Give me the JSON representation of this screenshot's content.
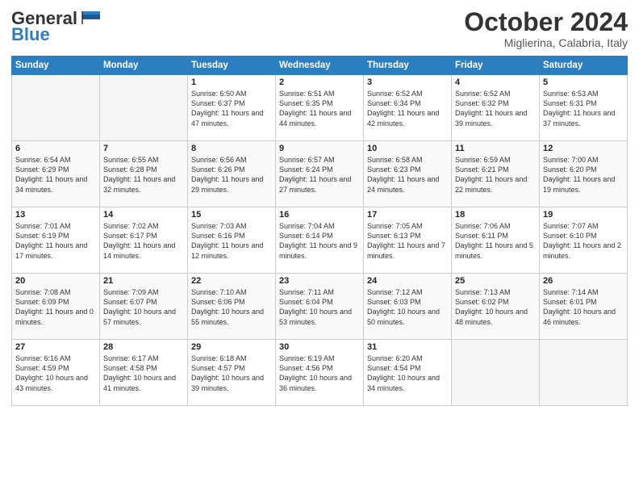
{
  "header": {
    "logo_general": "General",
    "logo_blue": "Blue",
    "month": "October 2024",
    "location": "Miglierina, Calabria, Italy"
  },
  "days_of_week": [
    "Sunday",
    "Monday",
    "Tuesday",
    "Wednesday",
    "Thursday",
    "Friday",
    "Saturday"
  ],
  "weeks": [
    [
      {
        "day": "",
        "empty": true
      },
      {
        "day": "",
        "empty": true
      },
      {
        "day": "1",
        "sunrise": "6:50 AM",
        "sunset": "6:37 PM",
        "daylight": "11 hours and 47 minutes."
      },
      {
        "day": "2",
        "sunrise": "6:51 AM",
        "sunset": "6:35 PM",
        "daylight": "11 hours and 44 minutes."
      },
      {
        "day": "3",
        "sunrise": "6:52 AM",
        "sunset": "6:34 PM",
        "daylight": "11 hours and 42 minutes."
      },
      {
        "day": "4",
        "sunrise": "6:52 AM",
        "sunset": "6:32 PM",
        "daylight": "11 hours and 39 minutes."
      },
      {
        "day": "5",
        "sunrise": "6:53 AM",
        "sunset": "6:31 PM",
        "daylight": "11 hours and 37 minutes."
      }
    ],
    [
      {
        "day": "6",
        "sunrise": "6:54 AM",
        "sunset": "6:29 PM",
        "daylight": "11 hours and 34 minutes."
      },
      {
        "day": "7",
        "sunrise": "6:55 AM",
        "sunset": "6:28 PM",
        "daylight": "11 hours and 32 minutes."
      },
      {
        "day": "8",
        "sunrise": "6:56 AM",
        "sunset": "6:26 PM",
        "daylight": "11 hours and 29 minutes."
      },
      {
        "day": "9",
        "sunrise": "6:57 AM",
        "sunset": "6:24 PM",
        "daylight": "11 hours and 27 minutes."
      },
      {
        "day": "10",
        "sunrise": "6:58 AM",
        "sunset": "6:23 PM",
        "daylight": "11 hours and 24 minutes."
      },
      {
        "day": "11",
        "sunrise": "6:59 AM",
        "sunset": "6:21 PM",
        "daylight": "11 hours and 22 minutes."
      },
      {
        "day": "12",
        "sunrise": "7:00 AM",
        "sunset": "6:20 PM",
        "daylight": "11 hours and 19 minutes."
      }
    ],
    [
      {
        "day": "13",
        "sunrise": "7:01 AM",
        "sunset": "6:19 PM",
        "daylight": "11 hours and 17 minutes."
      },
      {
        "day": "14",
        "sunrise": "7:02 AM",
        "sunset": "6:17 PM",
        "daylight": "11 hours and 14 minutes."
      },
      {
        "day": "15",
        "sunrise": "7:03 AM",
        "sunset": "6:16 PM",
        "daylight": "11 hours and 12 minutes."
      },
      {
        "day": "16",
        "sunrise": "7:04 AM",
        "sunset": "6:14 PM",
        "daylight": "11 hours and 9 minutes."
      },
      {
        "day": "17",
        "sunrise": "7:05 AM",
        "sunset": "6:13 PM",
        "daylight": "11 hours and 7 minutes."
      },
      {
        "day": "18",
        "sunrise": "7:06 AM",
        "sunset": "6:11 PM",
        "daylight": "11 hours and 5 minutes."
      },
      {
        "day": "19",
        "sunrise": "7:07 AM",
        "sunset": "6:10 PM",
        "daylight": "11 hours and 2 minutes."
      }
    ],
    [
      {
        "day": "20",
        "sunrise": "7:08 AM",
        "sunset": "6:09 PM",
        "daylight": "11 hours and 0 minutes."
      },
      {
        "day": "21",
        "sunrise": "7:09 AM",
        "sunset": "6:07 PM",
        "daylight": "10 hours and 57 minutes."
      },
      {
        "day": "22",
        "sunrise": "7:10 AM",
        "sunset": "6:06 PM",
        "daylight": "10 hours and 55 minutes."
      },
      {
        "day": "23",
        "sunrise": "7:11 AM",
        "sunset": "6:04 PM",
        "daylight": "10 hours and 53 minutes."
      },
      {
        "day": "24",
        "sunrise": "7:12 AM",
        "sunset": "6:03 PM",
        "daylight": "10 hours and 50 minutes."
      },
      {
        "day": "25",
        "sunrise": "7:13 AM",
        "sunset": "6:02 PM",
        "daylight": "10 hours and 48 minutes."
      },
      {
        "day": "26",
        "sunrise": "7:14 AM",
        "sunset": "6:01 PM",
        "daylight": "10 hours and 46 minutes."
      }
    ],
    [
      {
        "day": "27",
        "sunrise": "6:16 AM",
        "sunset": "4:59 PM",
        "daylight": "10 hours and 43 minutes."
      },
      {
        "day": "28",
        "sunrise": "6:17 AM",
        "sunset": "4:58 PM",
        "daylight": "10 hours and 41 minutes."
      },
      {
        "day": "29",
        "sunrise": "6:18 AM",
        "sunset": "4:57 PM",
        "daylight": "10 hours and 39 minutes."
      },
      {
        "day": "30",
        "sunrise": "6:19 AM",
        "sunset": "4:56 PM",
        "daylight": "10 hours and 36 minutes."
      },
      {
        "day": "31",
        "sunrise": "6:20 AM",
        "sunset": "4:54 PM",
        "daylight": "10 hours and 34 minutes."
      },
      {
        "day": "",
        "empty": true
      },
      {
        "day": "",
        "empty": true
      }
    ]
  ]
}
